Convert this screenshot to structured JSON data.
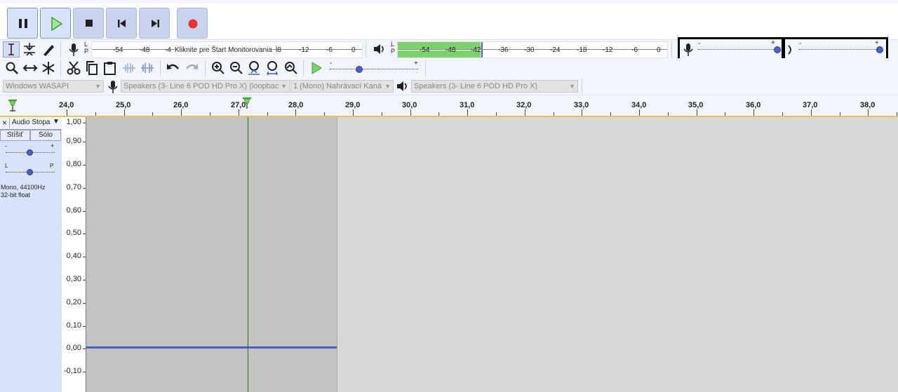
{
  "transport": {
    "pause": "pause-button",
    "play": "play-button",
    "stop": "stop-button",
    "skip_start": "skip-to-start-button",
    "skip_end": "skip-to-end-button",
    "record": "record-button"
  },
  "recording_meter": {
    "channels_l": "L",
    "channels_r": "P",
    "ticks": [
      "-54",
      "-48",
      "-4",
      "l8",
      "-12",
      "-6",
      "0"
    ],
    "monitor_text": "Kliknite pre Štart Monitorovania"
  },
  "playback_meter": {
    "channels_l": "L",
    "channels_r": "P",
    "ticks": [
      "-54",
      "-48",
      "-42",
      "-36",
      "-30",
      "-24",
      "-18",
      "-12",
      "-6",
      "0"
    ]
  },
  "mixer": {
    "minus": "-",
    "plus": "+",
    "recording_volume_level": 1.0,
    "playback_volume_level": 1.0
  },
  "play_at_speed": {
    "minus": "-",
    "plus": "+",
    "speed_level": 0.35
  },
  "devices": {
    "host": "Windows WASAPI",
    "recording_device": "Speakers (3- Line 6 POD HD Pro X) (loopbac",
    "channels": "1 (Mono) Nahrávací Kaná",
    "playback_device": "Speakers (3- Line 6 POD HD Pro X)"
  },
  "ruler": {
    "labels": [
      "24,0",
      "25,0",
      "26,0",
      "27,0",
      "28,0",
      "29,0",
      "30,0",
      "31,0",
      "32,0",
      "33,0",
      "34,0",
      "35,0",
      "36,0",
      "37,0",
      "38,0"
    ]
  },
  "track": {
    "close": "×",
    "name": "Audio Stopa",
    "mute": "Stíšiť",
    "solo": "Sólo",
    "gain_minus": "-",
    "gain_plus": "+",
    "pan_left": "L",
    "pan_right": "P",
    "info_line1": "Mono, 44100Hz",
    "info_line2": "32-bit float"
  },
  "vertical_scale": [
    "1,00",
    "0,90",
    "0,80",
    "0,70",
    "0,60",
    "0,50",
    "0,40",
    "0,30",
    "0,20",
    "0,10",
    "0,00",
    "-0,10"
  ],
  "colors": {
    "accent": "#4a5fc7",
    "playback_meter_fill": "#7bd16b",
    "record_red": "#e5332f",
    "toolbar_bg": "#f2f6fc",
    "track_panel": "#d7e3f8"
  }
}
